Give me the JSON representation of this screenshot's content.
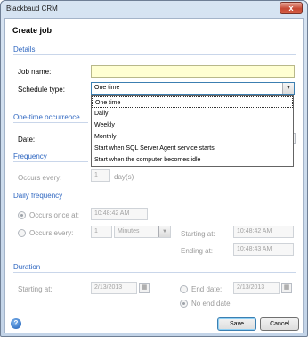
{
  "window": {
    "title": "Blackbaud CRM",
    "close_glyph": "x"
  },
  "dialog": {
    "heading": "Create job"
  },
  "details": {
    "section": "Details",
    "job_name_label": "Job name:",
    "job_name_value": "",
    "schedule_type_label": "Schedule type:",
    "schedule_type_value": "One time",
    "schedule_options": [
      "One time",
      "Daily",
      "Weekly",
      "Monthly",
      "Start when SQL Server Agent service starts",
      "Start when the computer becomes idle"
    ]
  },
  "one_time": {
    "section": "One-time occurrence",
    "date_label": "Date:"
  },
  "frequency": {
    "section": "Frequency",
    "occurs_every_label": "Occurs every:",
    "occurs_every_value": "1",
    "unit": "day(s)"
  },
  "daily_frequency": {
    "section": "Daily frequency",
    "occurs_once_label": "Occurs once at:",
    "occurs_once_value": "10:48:42 AM",
    "occurs_every_label": "Occurs every:",
    "occurs_every_value": "1",
    "interval_unit": "Minutes",
    "starting_label": "Starting at:",
    "starting_value": "10:48:42 AM",
    "ending_label": "Ending at:",
    "ending_value": "10:48:43 AM"
  },
  "duration": {
    "section": "Duration",
    "starting_label": "Starting at:",
    "starting_value": "2/13/2013",
    "end_date_label": "End date:",
    "end_date_value": "2/13/2013",
    "no_end_label": "No end date"
  },
  "footer": {
    "save": "Save",
    "cancel": "Cancel",
    "help_glyph": "?"
  }
}
